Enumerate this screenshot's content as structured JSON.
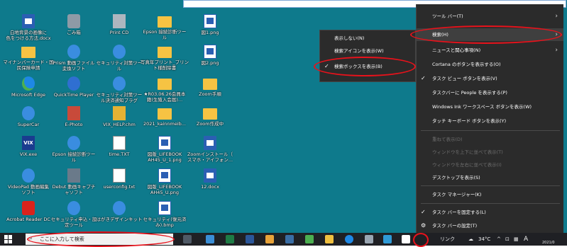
{
  "desktop_icons": [
    {
      "label": "白地背景の画像に\n色をつける方法.docx",
      "icon": "word-doc-icon"
    },
    {
      "label": "ごみ箱",
      "icon": "recycle-bin-icon"
    },
    {
      "label": "Print CD",
      "icon": "print-cd-icon"
    },
    {
      "label": "Epson 接続診断ツー\nル",
      "icon": "folder-icon"
    },
    {
      "label": "図1.png",
      "icon": "png-file-icon"
    },
    {
      "label": "マイナンバーカード・国\n民保険申請",
      "icon": "folder-icon"
    },
    {
      "label": "Prism 動画ファイル\n変換ソフト",
      "icon": "prism-app-icon"
    },
    {
      "label": "セキュリティ対策ツー\nル",
      "icon": "app-icon"
    },
    {
      "label": "写真年プリント_プリン\nト様削除書",
      "icon": "folder-icon"
    },
    {
      "label": "図2.png",
      "icon": "png-file-icon"
    },
    {
      "label": "Microsoft Edge",
      "icon": "edge-icon"
    },
    {
      "label": "QuickTime Player",
      "icon": "quicktime-icon"
    },
    {
      "label": "セキュリティ対策ツー\nル決済通知プラグ",
      "icon": "app-icon"
    },
    {
      "label": "★R03.06.26会員本\n籍(生殖入会届)...",
      "icon": "folder-icon"
    },
    {
      "label": "Zoom手順",
      "icon": "folder-icon"
    },
    {
      "label": "SuperCar",
      "icon": "app-icon"
    },
    {
      "label": "E-Photo",
      "icon": "photo-app-icon"
    },
    {
      "label": "VIX_HELP.chm",
      "icon": "chm-file-icon"
    },
    {
      "label": "2021_kainnmeib...",
      "icon": "folder-icon"
    },
    {
      "label": "Zoom作成中",
      "icon": "folder-icon"
    },
    {
      "label": "ViX.exe",
      "icon": "vix-app-icon"
    },
    {
      "label": "Epson 接続診断ツー\nル",
      "icon": "app-icon"
    },
    {
      "label": "time.TXT",
      "icon": "text-file-icon"
    },
    {
      "label": "図版_LIFEBOOK\nAH45_U_1.png",
      "icon": "png-file-icon"
    },
    {
      "label": "Zoomインストール（\nスマホ・アイフォン...",
      "icon": "word-doc-icon"
    },
    {
      "label": "VideoPad 動画編集\nソフト",
      "icon": "videopad-icon"
    },
    {
      "label": "Debut 動画キャプチ\nャソフト",
      "icon": "debut-app-icon"
    },
    {
      "label": "userconfig.txt",
      "icon": "text-file-icon"
    },
    {
      "label": "図版_LIFEBOOK\nAH45_U.png",
      "icon": "png-file-icon"
    },
    {
      "label": "12.docx",
      "icon": "word-doc-icon"
    },
    {
      "label": "Acrobat Reader DC",
      "icon": "acrobat-icon"
    },
    {
      "label": "セキュリティ申込・設\n定ツール",
      "icon": "app-icon"
    },
    {
      "label": "はがきデザインキット",
      "icon": "app-icon"
    },
    {
      "label": "セキュリティ(復元済\nみ).bmp",
      "icon": "bmp-file-icon"
    }
  ],
  "search_submenu": {
    "items": [
      {
        "label": "表示しない(N)",
        "checked": false
      },
      {
        "label": "検索アイコンを表示(W)",
        "checked": false
      },
      {
        "label": "検索ボックスを表示(B)",
        "checked": true
      }
    ]
  },
  "context_menu": {
    "items": [
      {
        "label": "ツール バー(T)",
        "type": "submenu",
        "enabled": true
      },
      {
        "label": "検索(H)",
        "type": "submenu",
        "enabled": true,
        "highlighted": true
      },
      {
        "label": "ニュースと関心事項(N)",
        "type": "submenu",
        "enabled": true
      },
      {
        "label": "Cortana のボタンを表示する(O)",
        "type": "item",
        "enabled": true
      },
      {
        "label": "タスク ビュー ボタンを表示(V)",
        "type": "item",
        "enabled": true,
        "checked": true
      },
      {
        "label": "タスクバーに People を表示する(P)",
        "type": "item",
        "enabled": true
      },
      {
        "label": "Windows Ink ワークスペース ボタンを表示(W)",
        "type": "item",
        "enabled": true
      },
      {
        "label": "タッチ キーボード ボタンを表示(Y)",
        "type": "item",
        "enabled": true
      },
      {
        "label": "重ねて表示(D)",
        "type": "item",
        "enabled": false
      },
      {
        "label": "ウィンドウを上下に並べて表示(T)",
        "type": "item",
        "enabled": false
      },
      {
        "label": "ウィンドウを左右に並べて表示(I)",
        "type": "item",
        "enabled": false
      },
      {
        "label": "デスクトップを表示(S)",
        "type": "item",
        "enabled": true
      },
      {
        "label": "タスク マネージャー(K)",
        "type": "item",
        "enabled": true
      },
      {
        "label": "タスク バーを固定する(L)",
        "type": "item",
        "enabled": true,
        "checked": true
      },
      {
        "label": "タスク バーの設定(T)",
        "type": "item",
        "enabled": true,
        "icon": "gear-icon"
      }
    ]
  },
  "taskbar": {
    "search_placeholder": "ここに入力して検索",
    "link_label": "リンク",
    "weather": "34°C",
    "ime": "A",
    "year_fragment": "2021/0",
    "accent_color": "#0078d7"
  },
  "annotation_color": "#e8121b"
}
